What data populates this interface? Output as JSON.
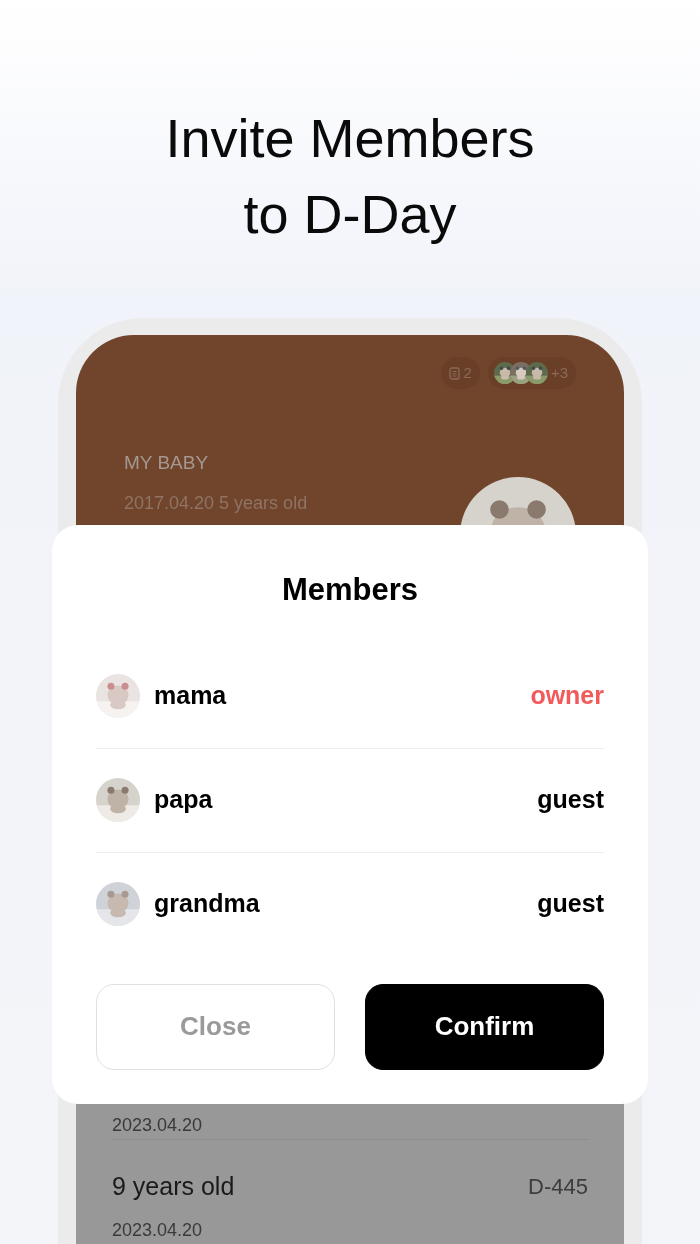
{
  "headline_lines": [
    "Invite Members",
    "to D-Day"
  ],
  "dday_card": {
    "doc_count": "2",
    "extra_members": "+3",
    "title": "MY BABY",
    "subtitle": "2017.04.20 5 years old"
  },
  "members_sheet": {
    "title": "Members",
    "members": [
      {
        "name": "mama",
        "role": "owner",
        "color": "#f25a5a"
      },
      {
        "name": "papa",
        "role": "guest",
        "color": "#000000"
      },
      {
        "name": "grandma",
        "role": "guest",
        "color": "#000000"
      }
    ],
    "buttons": [
      {
        "label": "Close",
        "kind": "secondary"
      },
      {
        "label": "Confirm",
        "kind": "primary"
      }
    ]
  },
  "milestones": [
    {
      "date": "2023.04.20"
    },
    {
      "title": "9 years old",
      "dday": "D-445",
      "date": "2023.04.20"
    }
  ]
}
